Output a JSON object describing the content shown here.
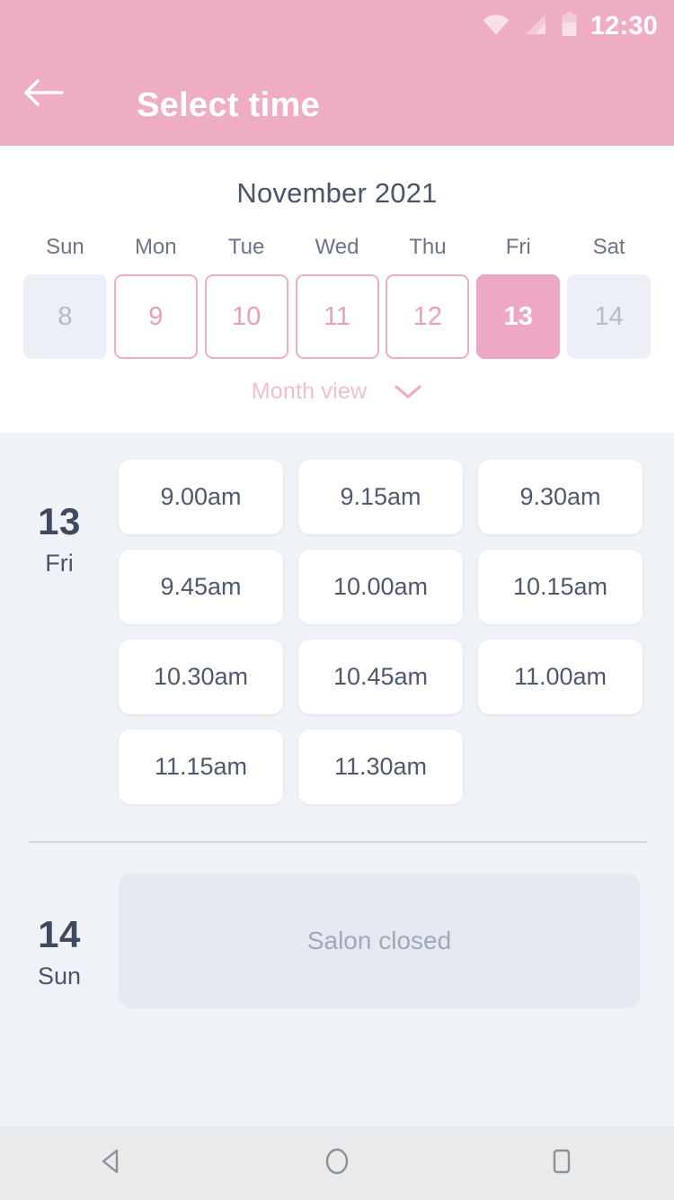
{
  "status_bar": {
    "time": "12:30",
    "icons": [
      "wifi-icon",
      "cellular-signal-icon",
      "battery-icon"
    ]
  },
  "header": {
    "title": "Select time",
    "back_icon": "arrow-left-icon",
    "background_color": "#eeadc5"
  },
  "calendar": {
    "month_title": "November 2021",
    "weekdays": [
      "Sun",
      "Mon",
      "Tue",
      "Wed",
      "Thu",
      "Fri",
      "Sat"
    ],
    "days": [
      {
        "number": "8",
        "state": "disabled"
      },
      {
        "number": "9",
        "state": "available"
      },
      {
        "number": "10",
        "state": "available"
      },
      {
        "number": "11",
        "state": "available"
      },
      {
        "number": "12",
        "state": "available"
      },
      {
        "number": "13",
        "state": "selected"
      },
      {
        "number": "14",
        "state": "disabled"
      }
    ],
    "view_toggle": {
      "label": "Month view",
      "chevron_icon": "chevron-down-icon"
    },
    "accent_color": "#eda9c3"
  },
  "schedule": {
    "open_day": {
      "day_number": "13",
      "day_of_week": "Fri",
      "slots": [
        "9.00am",
        "9.15am",
        "9.30am",
        "9.45am",
        "10.00am",
        "10.15am",
        "10.30am",
        "10.45am",
        "11.00am",
        "11.15am",
        "11.30am"
      ]
    },
    "closed_day": {
      "day_number": "14",
      "day_of_week": "Sun",
      "message": "Salon closed"
    }
  },
  "nav_bar": {
    "buttons": [
      {
        "name": "back-triangle-icon"
      },
      {
        "name": "home-circle-icon"
      },
      {
        "name": "recents-square-icon"
      }
    ]
  }
}
